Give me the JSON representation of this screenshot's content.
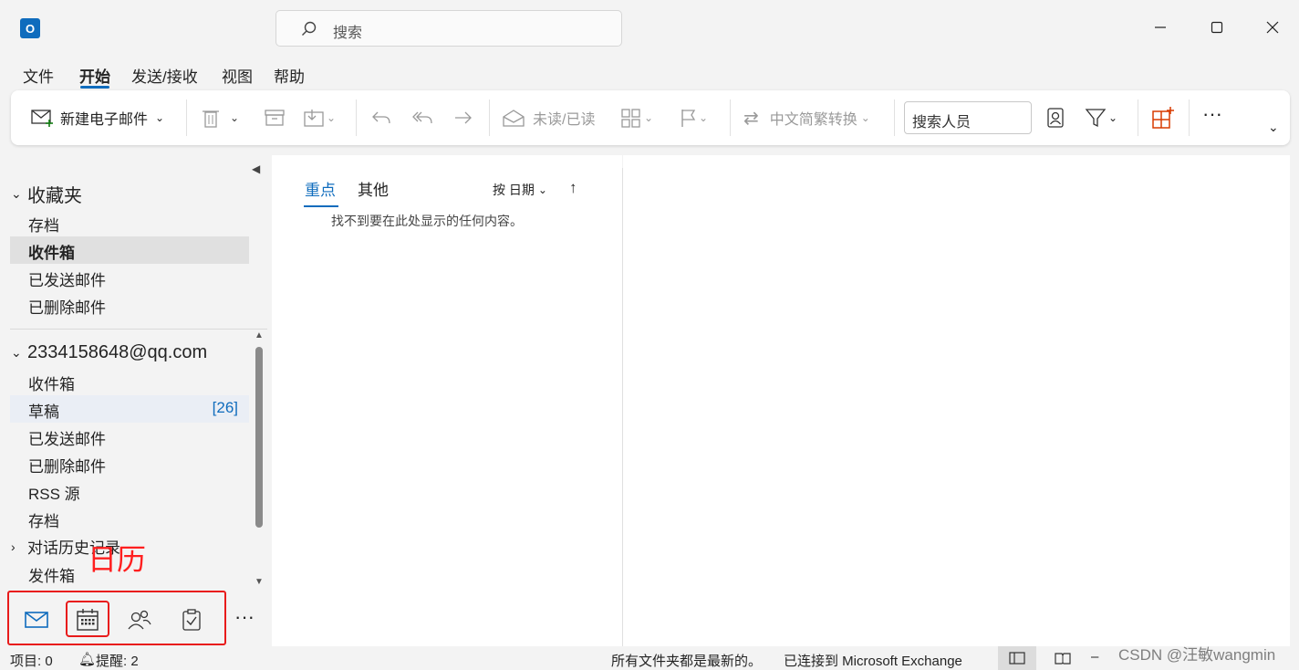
{
  "titlebar": {
    "app_icon_letter": "O",
    "search_placeholder": "搜索"
  },
  "menu": [
    "文件",
    "开始",
    "发送/接收",
    "视图",
    "帮助"
  ],
  "ribbon": {
    "new_email": "新建电子邮件",
    "read_unread": "未读/已读",
    "convert": "中文简繁转换",
    "people_search": "搜索人员"
  },
  "folders": {
    "favorites": {
      "title": "收藏夹",
      "items": [
        "存档",
        "收件箱",
        "已发送邮件",
        "已删除邮件"
      ]
    },
    "account": {
      "title": "2334158648@qq.com",
      "items": [
        "收件箱",
        "草稿",
        "已发送邮件",
        "已删除邮件",
        "RSS 源",
        "存档"
      ],
      "drafts_count": "[26]",
      "conversation_history": "对话历史记录",
      "outbox": "发件箱"
    }
  },
  "annotation": "日历",
  "list": {
    "tab_focused": "重点",
    "tab_other": "其他",
    "sort_label": "按 日期",
    "empty_message": "找不到要在此处显示的任何内容。"
  },
  "status": {
    "items": "项目: 0",
    "reminders": "提醒: 2",
    "all_folders": "所有文件夹都是最新的。",
    "connected": "已连接到 Microsoft Exchange"
  },
  "watermark": "CSDN @汪敏wangmin"
}
